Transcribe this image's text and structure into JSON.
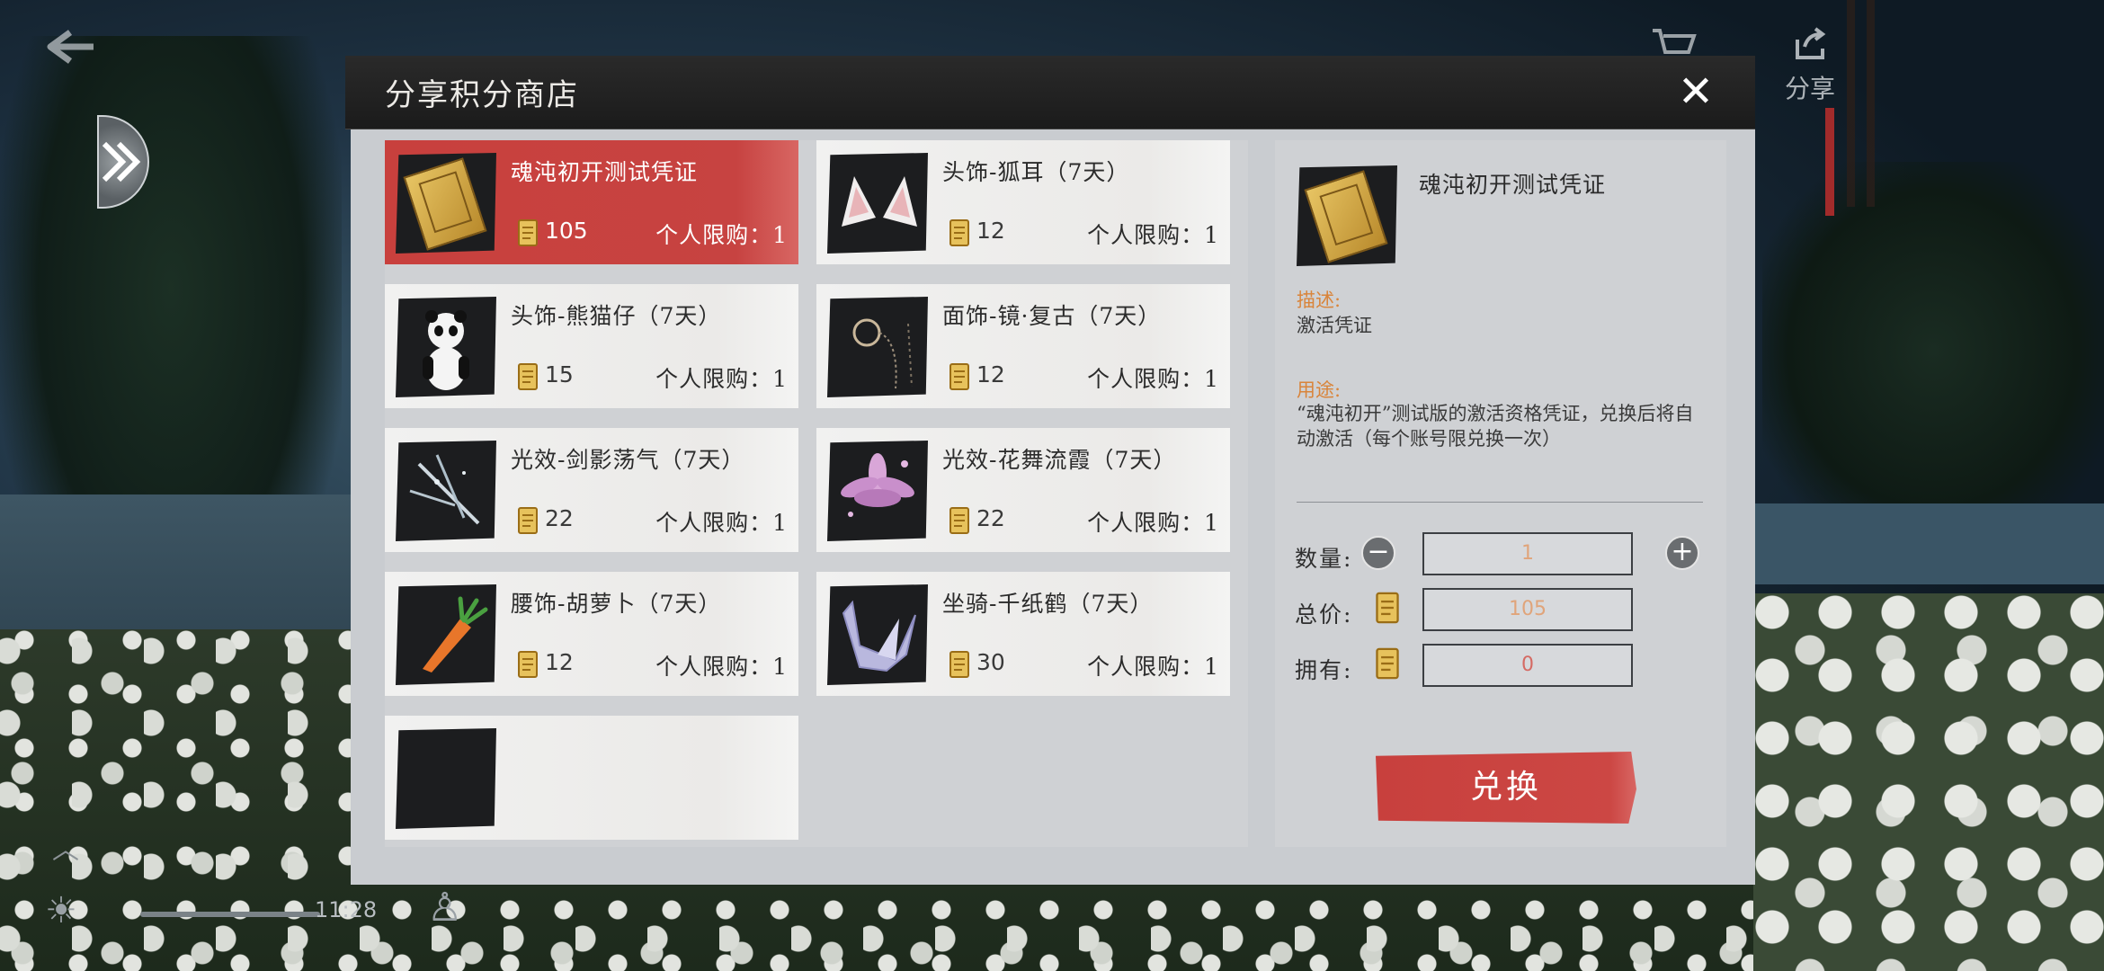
{
  "window": {
    "title": "分享积分商店",
    "close_label": "✕"
  },
  "hud": {
    "back_icon": "back-arrow-icon",
    "share_label": "分享",
    "time": "11:28"
  },
  "colors": {
    "selected_card": "#c8403d",
    "exchange_button": "#c8403d",
    "label_orange": "#d9843a",
    "modal_body": "#c9ccd0"
  },
  "items": [
    {
      "name": "魂沌初开测试凭证",
      "price": "105",
      "limit": "个人限购：1",
      "icon": "ticket-icon",
      "selected": true
    },
    {
      "name": "头饰-狐耳（7天）",
      "price": "12",
      "limit": "个人限购：1",
      "icon": "fox-ears-icon",
      "selected": false
    },
    {
      "name": "头饰-熊猫仔（7天）",
      "price": "15",
      "limit": "个人限购：1",
      "icon": "panda-icon",
      "selected": false
    },
    {
      "name": "面饰-镜·复古（7天）",
      "price": "12",
      "limit": "个人限购：1",
      "icon": "monocle-icon",
      "selected": false
    },
    {
      "name": "光效-剑影荡气（7天）",
      "price": "22",
      "limit": "个人限购：1",
      "icon": "sword-effect-icon",
      "selected": false
    },
    {
      "name": "光效-花舞流霞（7天）",
      "price": "22",
      "limit": "个人限购：1",
      "icon": "flower-effect-icon",
      "selected": false
    },
    {
      "name": "腰饰-胡萝卜（7天）",
      "price": "12",
      "limit": "个人限购：1",
      "icon": "carrot-icon",
      "selected": false
    },
    {
      "name": "坐骑-千纸鹤（7天）",
      "price": "30",
      "limit": "个人限购：1",
      "icon": "paper-crane-icon",
      "selected": false
    },
    {
      "name": "",
      "price": "",
      "limit": "",
      "icon": "",
      "selected": false
    }
  ],
  "detail": {
    "name": "魂沌初开测试凭证",
    "desc_label": "描述:",
    "desc": "激活凭证",
    "use_label": "用途:",
    "use": "“魂沌初开”测试版的激活资格凭证，兑换后将自动激活（每个账号限兑换一次）",
    "quantity_label": "数量:",
    "quantity": "1",
    "total_label": "总价:",
    "total": "105",
    "owned_label": "拥有:",
    "owned": "0",
    "exchange_label": "兑换"
  }
}
